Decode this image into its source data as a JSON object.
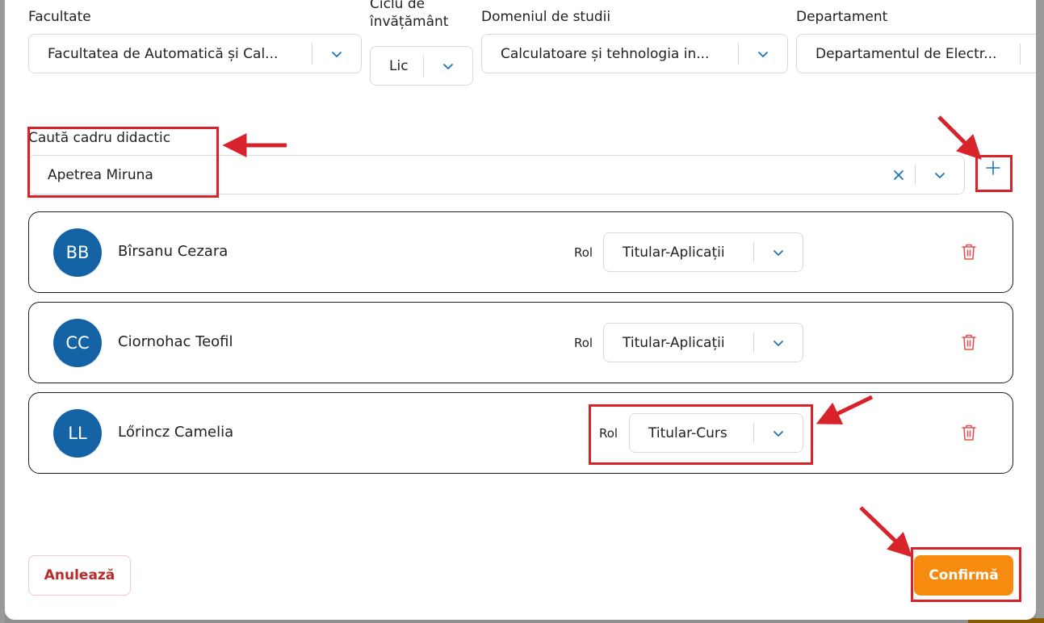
{
  "filters": {
    "faculty": {
      "label": "Facultate",
      "value": "Facultatea de Automatică și Cal..."
    },
    "cycle": {
      "label": "Ciclu de învățământ",
      "value": "Lic"
    },
    "domain": {
      "label": "Domeniul de studii",
      "value": "Calculatoare și tehnologia in..."
    },
    "department": {
      "label": "Departament",
      "value": "Departamentul de Electr..."
    }
  },
  "search": {
    "label": "Caută cadru didactic",
    "value": "Apetrea Miruna"
  },
  "role_label": "Rol",
  "teachers": [
    {
      "initials": "BB",
      "name": "Bîrsanu Cezara",
      "role": "Titular-Aplicații"
    },
    {
      "initials": "CC",
      "name": "Ciornohac Teofil",
      "role": "Titular-Aplicații"
    },
    {
      "initials": "LL",
      "name": "Lőrincz Camelia",
      "role": "Titular-Curs"
    }
  ],
  "actions": {
    "cancel": "Anulează",
    "confirm": "Confirmă"
  },
  "colors": {
    "primary": "#1464a5",
    "accent": "#f68b0f",
    "danger": "#d8232a",
    "chevron": "#1a73c0"
  }
}
